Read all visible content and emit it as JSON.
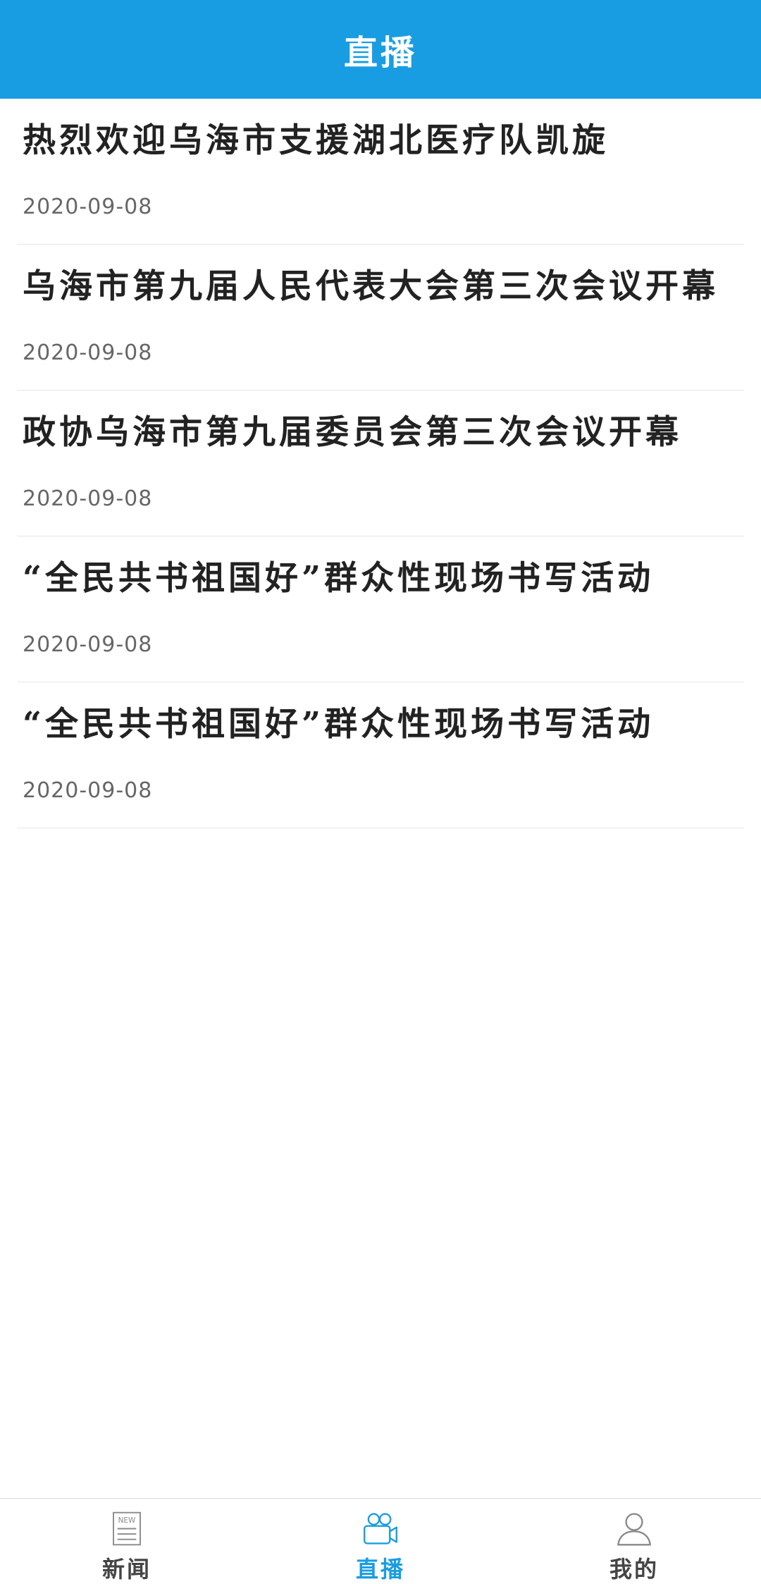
{
  "header": {
    "title": "直播"
  },
  "items": [
    {
      "title": "热烈欢迎乌海市支援湖北医疗队凯旋",
      "date": "2020-09-08"
    },
    {
      "title": "乌海市第九届人民代表大会第三次会议开幕",
      "date": "2020-09-08"
    },
    {
      "title": "政协乌海市第九届委员会第三次会议开幕",
      "date": "2020-09-08"
    },
    {
      "title": "“全民共书祖国好”群众性现场书写活动",
      "date": "2020-09-08"
    },
    {
      "title": "“全民共书祖国好”群众性现场书写活动",
      "date": "2020-09-08"
    }
  ],
  "tabbar": {
    "tabs": [
      {
        "label": "新闻",
        "icon": "news-icon",
        "active": false,
        "icon_text": "NEW"
      },
      {
        "label": "直播",
        "icon": "video-camera-icon",
        "active": true
      },
      {
        "label": "我的",
        "icon": "user-icon",
        "active": false
      }
    ]
  },
  "colors": {
    "accent": "#199de2",
    "title_text": "#222222",
    "date_text": "#666666",
    "inactive_tab": "#444444"
  }
}
